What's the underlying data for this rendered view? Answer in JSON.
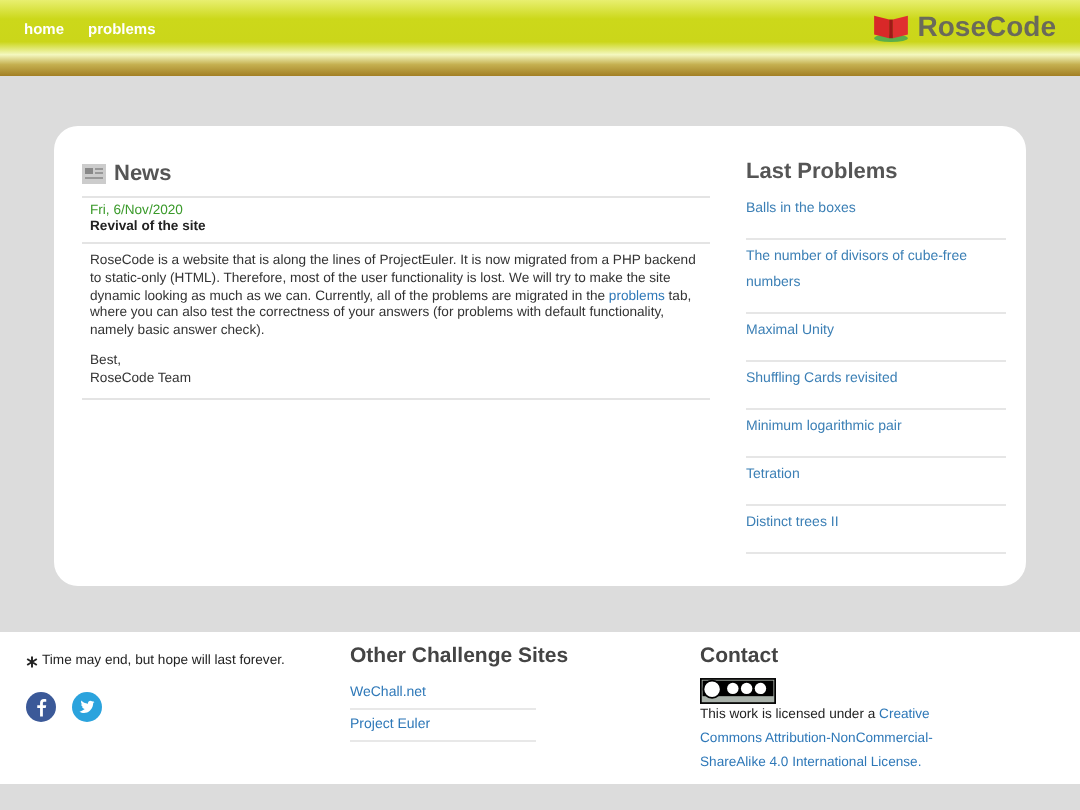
{
  "nav": {
    "links": [
      "home",
      "problems"
    ],
    "brand": "RoseCode"
  },
  "news": {
    "title": "News",
    "date": "Fri, 6/Nov/2020",
    "headline": "Revival of the site",
    "body_before": "RoseCode is a website that is along the lines of ProjectEuler. It is now migrated from a PHP backend to static-only (HTML). Therefore, most of the user functionality is lost. We will try to make the site dynamic looking as much as we can. Currently, all of the problems are migrated in the",
    "body_link": "problems",
    "body_after": "tab, where you can also test the correctness of your answers (for problems with default functionality, namely basic answer check).",
    "signoff": [
      "Best,",
      "RoseCode Team"
    ]
  },
  "last_problems": {
    "title": "Last Problems",
    "items": [
      "Balls in the boxes",
      "The number of divisors of cube-free numbers",
      "Maximal Unity",
      "Shuffling Cards revisited",
      "Minimum logarithmic pair",
      "Tetration",
      "Distinct trees II"
    ]
  },
  "footer": {
    "motto": "Time may end, but hope will last forever.",
    "other_title": "Other Challenge Sites",
    "sites": [
      "WeChall.net",
      "Project Euler"
    ],
    "contact_title": "Contact",
    "license_before": "This work is licensed under a",
    "license_link_lines": [
      "Creative",
      "Commons Attribution-NonCommercial-",
      "ShareAlike 4.0 International License."
    ]
  }
}
